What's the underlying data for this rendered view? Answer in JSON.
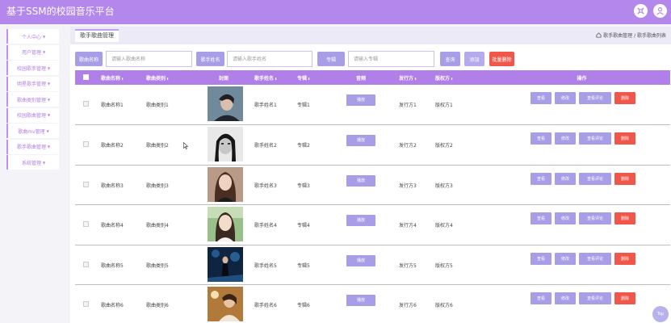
{
  "app": {
    "title": "基于SSM的校园音乐平台",
    "accent": "#b387ec",
    "icons": [
      "settings-icon",
      "user-icon"
    ]
  },
  "sidebar": {
    "items": [
      {
        "label": "个人中心"
      },
      {
        "label": "用户管理"
      },
      {
        "label": "校园歌手管理"
      },
      {
        "label": "明星歌手管理"
      },
      {
        "label": "歌曲类别管理"
      },
      {
        "label": "校园歌曲管理"
      },
      {
        "label": "歌曲mv管理"
      },
      {
        "label": "歌手歌曲管理"
      },
      {
        "label": "系统管理"
      }
    ]
  },
  "breadcrumb": {
    "tab": "歌手歌曲管理",
    "path": "歌手歌曲管理 / 歌手歌曲列表"
  },
  "search": {
    "song_label": "歌曲名称",
    "song_placeholder": "请输入歌曲名称",
    "singer_label": "歌手姓名",
    "singer_placeholder": "请输入歌手姓名",
    "album_label": "专辑",
    "album_placeholder": "请输入专辑",
    "query_label": "查询",
    "add_label": "添加",
    "batch_delete_label": "批量删除"
  },
  "table": {
    "headers": {
      "song_name": "歌曲名称",
      "song_type": "歌曲类别",
      "cover": "封面",
      "singer": "歌手姓名",
      "album": "专辑",
      "audio": "音频",
      "publisher": "发行方",
      "copyright": "版权方",
      "ops": "操作"
    },
    "rows": [
      {
        "song_name": "歌曲名称1",
        "song_type": "歌曲类别1",
        "singer": "歌手姓名1",
        "album": "专辑1",
        "play": "播放",
        "publisher": "发行方1",
        "copyright": "版权方1"
      },
      {
        "song_name": "歌曲名称2",
        "song_type": "歌曲类别2",
        "singer": "歌手姓名2",
        "album": "专辑2",
        "play": "播放",
        "publisher": "发行方2",
        "copyright": "版权方2"
      },
      {
        "song_name": "歌曲名称3",
        "song_type": "歌曲类别3",
        "singer": "歌手姓名3",
        "album": "专辑3",
        "play": "播放",
        "publisher": "发行方3",
        "copyright": "版权方3"
      },
      {
        "song_name": "歌曲名称4",
        "song_type": "歌曲类别4",
        "singer": "歌手姓名4",
        "album": "专辑4",
        "play": "播放",
        "publisher": "发行方4",
        "copyright": "版权方4"
      },
      {
        "song_name": "歌曲名称5",
        "song_type": "歌曲类别5",
        "singer": "歌手姓名5",
        "album": "专辑5",
        "play": "播放",
        "publisher": "发行方5",
        "copyright": "版权方5"
      },
      {
        "song_name": "歌曲名称6",
        "song_type": "歌曲类别6",
        "singer": "歌手姓名6",
        "album": "专辑6",
        "play": "播放",
        "publisher": "发行方6",
        "copyright": "版权方6"
      }
    ],
    "ops": {
      "view": "查看",
      "edit": "修改",
      "comments": "查看评论",
      "delete": "删除"
    }
  },
  "float_top": "Top",
  "colors": {
    "header_row": "#b17fe8",
    "button": "#a89ee8",
    "delete": "#f0574a"
  }
}
